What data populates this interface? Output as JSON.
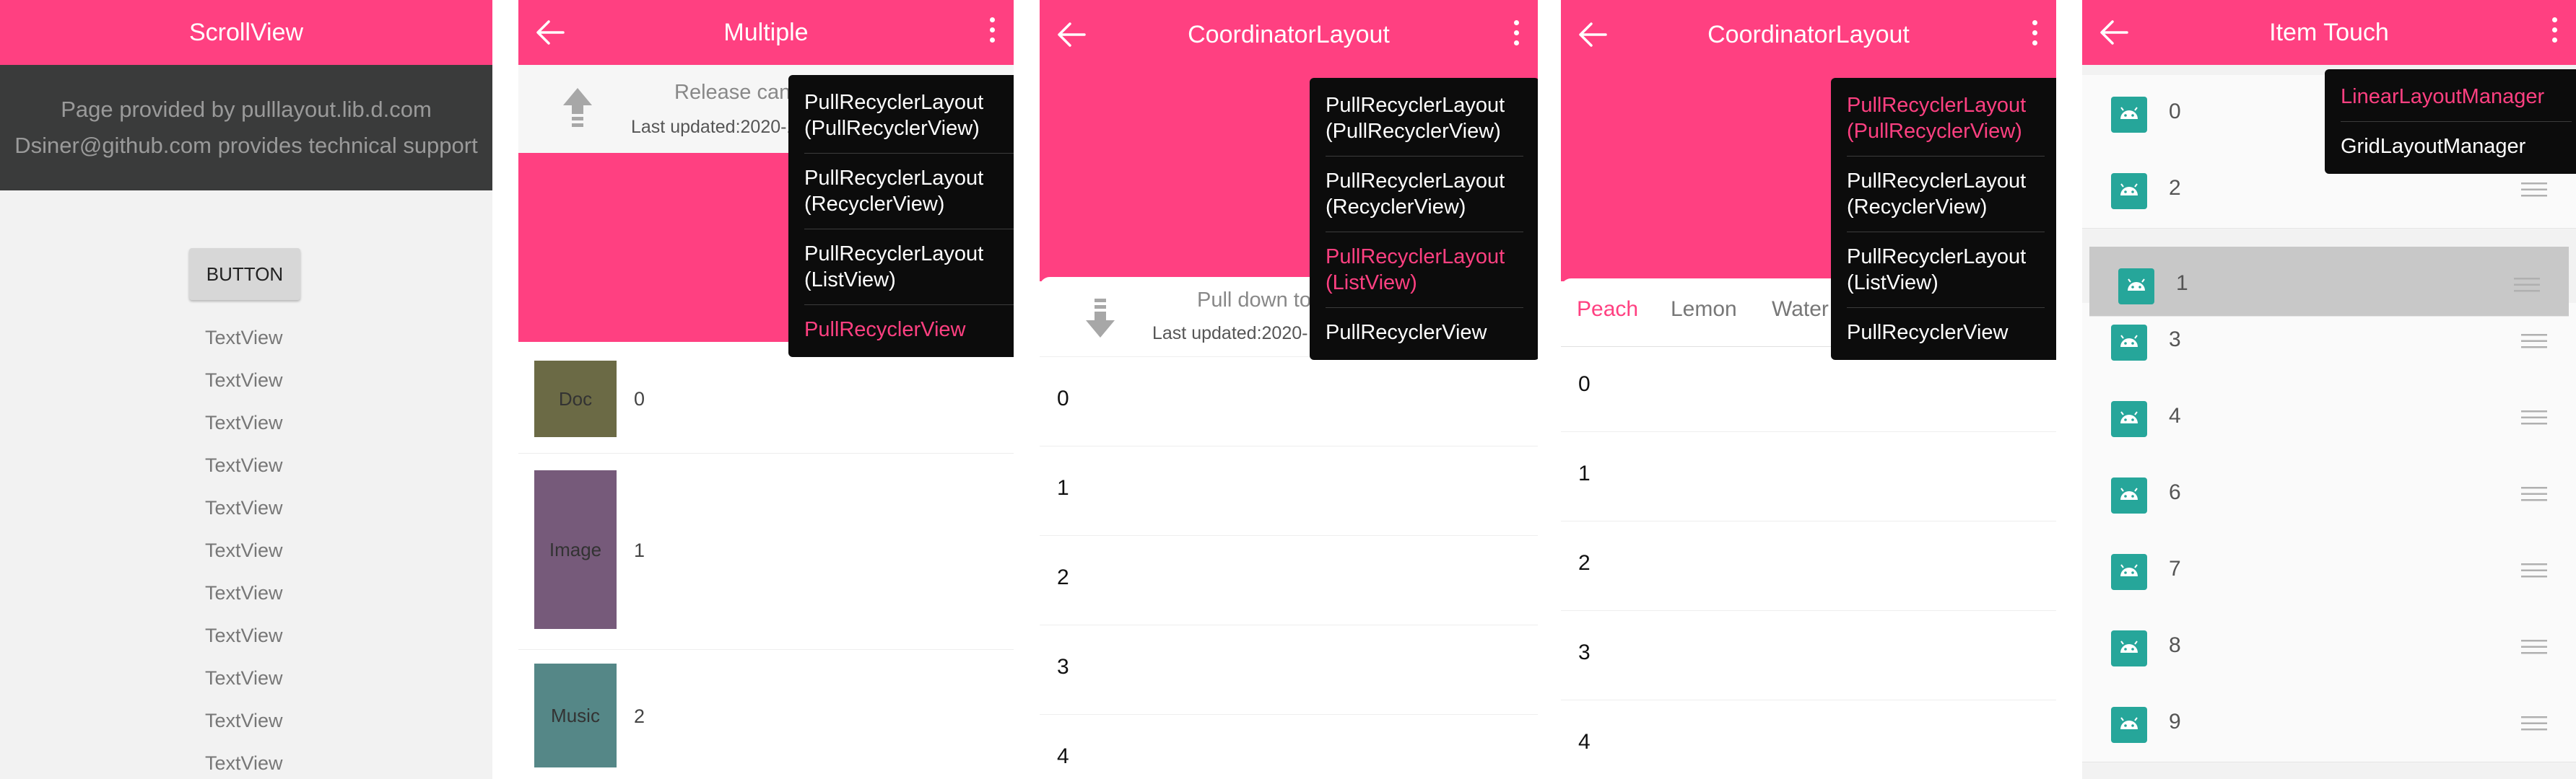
{
  "panels": {
    "scrollview": {
      "title": "ScrollView",
      "header_line1": "Page provided by pulllayout.lib.d.com",
      "header_line2": "Dsiner@github.com provides technical support",
      "button_label": "BUTTON",
      "text_items": [
        "TextView",
        "TextView",
        "TextView",
        "TextView",
        "TextView",
        "TextView",
        "TextView",
        "TextView",
        "TextView",
        "TextView",
        "TextView"
      ]
    },
    "multiple": {
      "title": "Multiple",
      "refresh_title": "Release can",
      "refresh_time": "Last updated:2020-1",
      "rows": [
        {
          "label": "Doc",
          "num": "0",
          "color": "#6b6a45"
        },
        {
          "label": "Image",
          "num": "1",
          "color": "#765a7a"
        },
        {
          "label": "Music",
          "num": "2",
          "color": "#558787"
        }
      ],
      "menu": [
        "PullRecyclerLayout\n(PullRecyclerView)",
        "PullRecyclerLayout\n(RecyclerView)",
        "PullRecyclerLayout\n(ListView)",
        "PullRecyclerView"
      ],
      "menu_active_index": 3
    },
    "coordinator1": {
      "title": "CoordinatorLayout",
      "pull_title": "Pull down to",
      "pull_time": "Last updated:2020-",
      "rows": [
        "0",
        "1",
        "2",
        "3",
        "4"
      ],
      "menu": [
        "PullRecyclerLayout\n(PullRecyclerView)",
        "PullRecyclerLayout\n(RecyclerView)",
        "PullRecyclerLayout\n(ListView)",
        "PullRecyclerView"
      ],
      "menu_active_index": 2
    },
    "coordinator2": {
      "title": "CoordinatorLayout",
      "tabs": [
        "Peach",
        "Lemon",
        "Water"
      ],
      "active_tab": "Peach",
      "rows": [
        "0",
        "1",
        "2",
        "3",
        "4"
      ],
      "menu": [
        "PullRecyclerLayout\n(PullRecyclerView)",
        "PullRecyclerLayout\n(RecyclerView)",
        "PullRecyclerLayout\n(ListView)",
        "PullRecyclerView"
      ],
      "menu_active_index": 0
    },
    "itemtouch": {
      "title": "Item Touch",
      "rows": [
        "0",
        "2",
        "1",
        "3",
        "4",
        "6",
        "7",
        "8",
        "9"
      ],
      "selected_row": "1",
      "menu": [
        "LinearLayoutManager",
        "GridLayoutManager"
      ],
      "menu_active_index": 0
    }
  },
  "colors": {
    "accent": "#ff4081",
    "menu_bg": "#0c0c0c",
    "android_icon": "#26a69a"
  },
  "icons": [
    "back-arrow-icon",
    "more-vert-icon",
    "arrow-up-icon",
    "arrow-down-icon",
    "android-icon",
    "drag-handle-icon"
  ]
}
